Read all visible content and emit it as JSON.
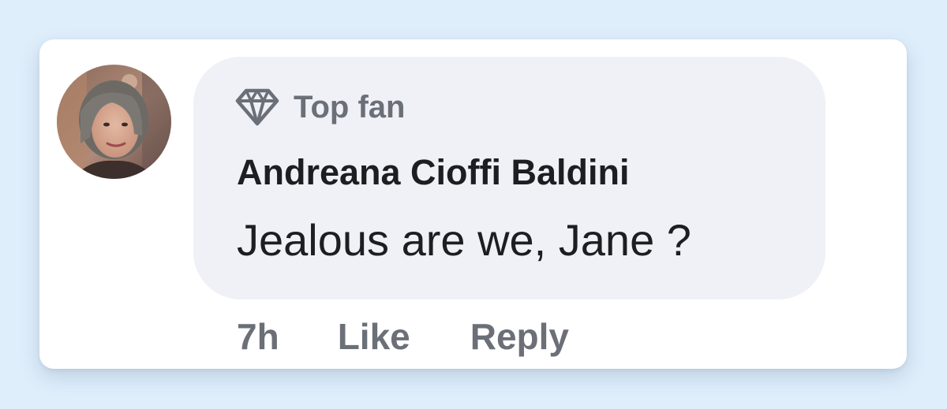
{
  "comment": {
    "avatar_icon": "user-avatar-photo",
    "badge": {
      "icon": "diamond-icon",
      "label": "Top fan"
    },
    "author": "Andreana Cioffi Baldini",
    "text": "Jealous are we, Jane ?",
    "timestamp": "7h",
    "like_label": "Like",
    "reply_label": "Reply"
  },
  "colors": {
    "page_background": "#dfeefb",
    "card_background": "#ffffff",
    "bubble_background": "#eff1f6",
    "primary_text": "#1c1e21",
    "secondary_text": "#6b6f77"
  }
}
